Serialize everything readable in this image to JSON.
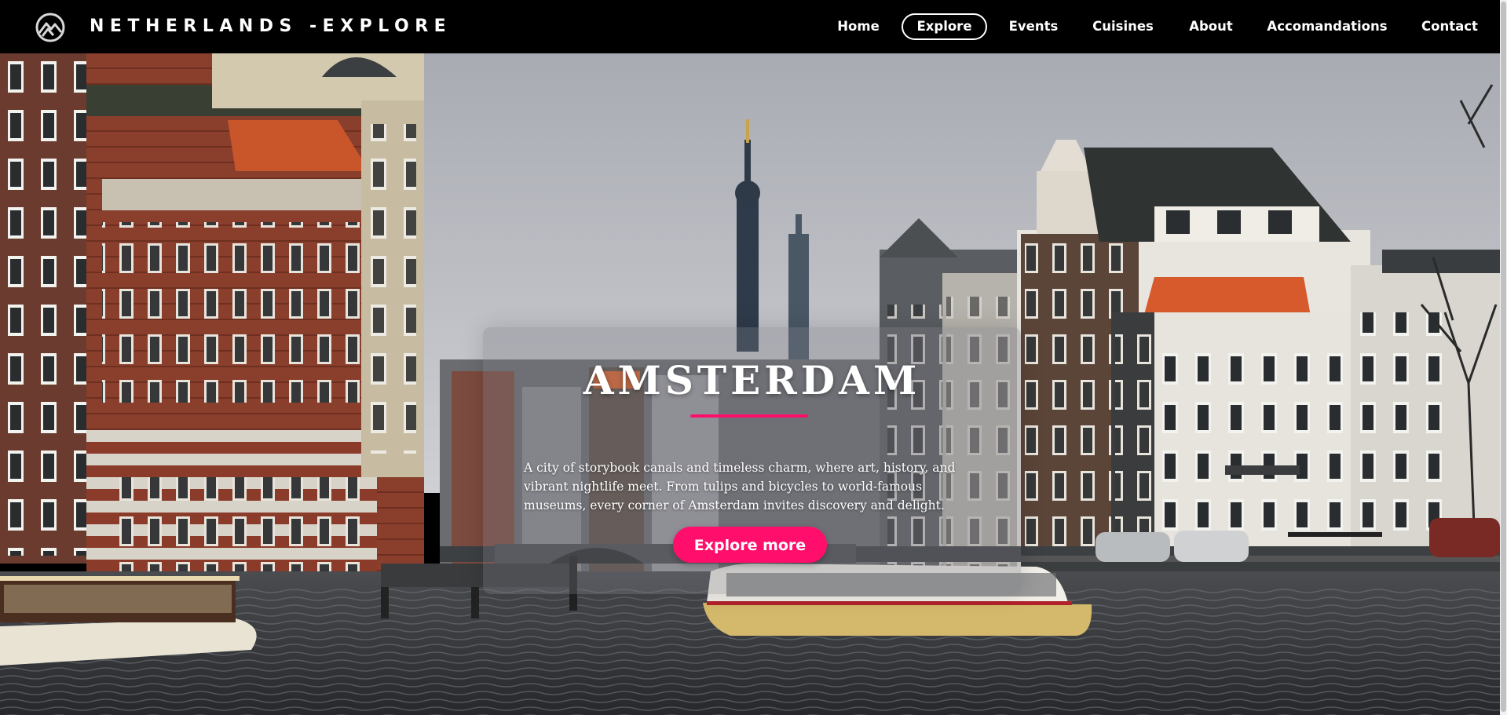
{
  "brand": {
    "name": "NETHERLANDS -EXPLORE",
    "logo_icon": "mountain-circle-icon"
  },
  "nav": {
    "items": [
      {
        "label": "Home",
        "active": false
      },
      {
        "label": "Explore",
        "active": true
      },
      {
        "label": "Events",
        "active": false
      },
      {
        "label": "Cuisines",
        "active": false
      },
      {
        "label": "About",
        "active": false
      },
      {
        "label": "Accomandations",
        "active": false
      },
      {
        "label": "Contact",
        "active": false
      }
    ]
  },
  "hero": {
    "background": "amsterdam-canal-photo",
    "title": "AMSTERDAM",
    "description": "A city of storybook canals and timeless charm, where art, history, and vibrant nightlife meet. From tulips and bicycles to world-famous museums, every corner of Amsterdam invites discovery and delight.",
    "cta_label": "Explore more"
  },
  "colors": {
    "navbar_bg": "#000000",
    "accent": "#ff0f6b",
    "text": "#ffffff"
  }
}
